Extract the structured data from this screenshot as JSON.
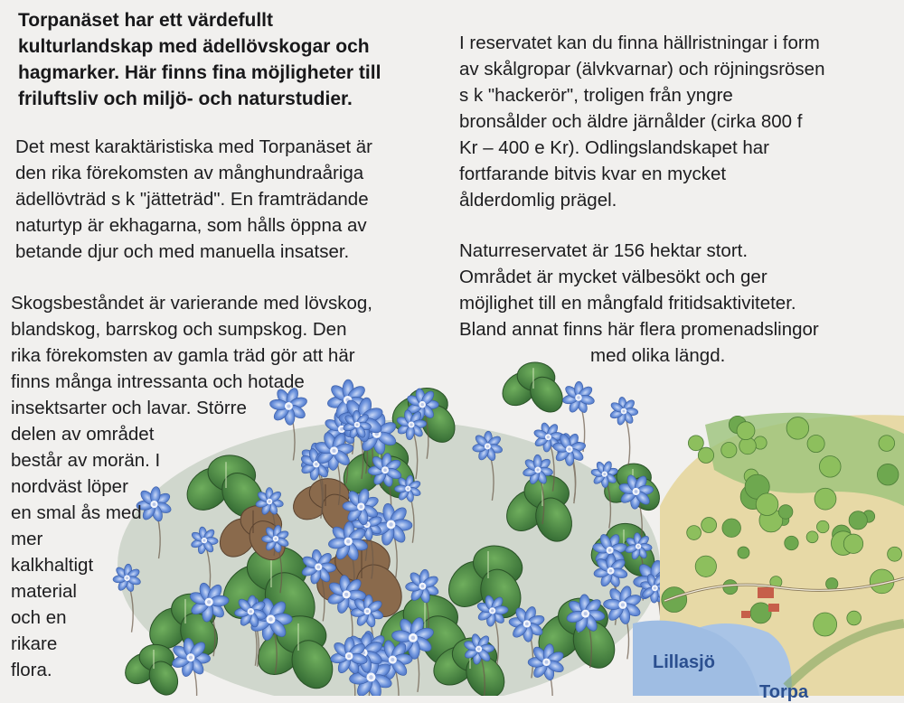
{
  "left_column": {
    "intro_lines": [
      "Torpanäset har ett värdefullt",
      "kulturlandskap med ädellövskogar och",
      "hagmarker. Här finns fina möjligheter till",
      "friluftsliv och miljö- och naturstudier."
    ],
    "para1_lines": [
      "Det mest karaktäristiska med Torpanäset är",
      "den rika förekomsten av månghundraåriga",
      "ädellövträd s k \"jätteträd\". En framträdande",
      "naturtyp är ekhagarna, som hålls öppna av",
      "betande djur och med manuella insatser."
    ],
    "para2_lines": [
      "Skogsbeståndet är varierande med lövskog,",
      "blandskog, barrskog och sumpskog. Den",
      "rika förekomsten av gamla träd gör att här",
      "finns många intressanta och hotade",
      "insektsarter och lavar. Större",
      "delen av området",
      "består av morän. I",
      "nordväst löper",
      "en smal ås med",
      "mer",
      "kalkhaltigt",
      "material",
      "och en",
      "rikare",
      "flora."
    ]
  },
  "right_column": {
    "para1_lines": [
      "I reservatet kan du finna hällristningar i form",
      "av skålgropar (älvkvarnar) och röjningsrösen",
      "s k \"hackerör\", troligen från yngre",
      "bronsålder och äldre järnålder (cirka 800 f",
      "Kr – 400 e Kr). Odlingslandskapet har",
      "fortfarande bitvis kvar en mycket",
      "ålderdomlig prägel."
    ],
    "para2_lines": [
      "Naturreservatet är 156 hektar stort.",
      "Området är mycket välbesökt och ger",
      "möjlighet till en mångfald fritidsaktiviteter.",
      "Bland annat finns här flera promenadslingor",
      "med olika längd."
    ]
  },
  "map": {
    "lake_label": "Lillasjö",
    "place_label": "Torpa"
  },
  "colors": {
    "background": "#f1f0ee",
    "text": "#1d1d1f",
    "flower_blue": "#5b84d6",
    "leaf_green": "#3f7a3a",
    "lake_blue": "#a9c4e6",
    "map_label": "#2b4f8f"
  }
}
